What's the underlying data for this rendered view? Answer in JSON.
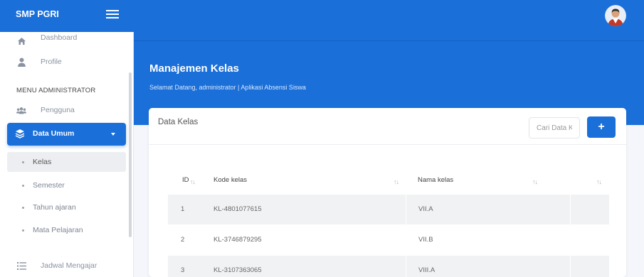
{
  "app": {
    "brand": "SMP PGRI"
  },
  "sidebar": {
    "items": [
      {
        "label": "Dashboard",
        "icon": "home-icon"
      },
      {
        "label": "Profile",
        "icon": "user-icon"
      }
    ],
    "section_heading": "MENU ADMINISTRATOR",
    "pengguna": {
      "label": "Pengguna",
      "icon": "users-icon"
    },
    "active_group": {
      "label": "Data Umum",
      "icon": "layers-icon"
    },
    "sub_items": [
      {
        "label": "Kelas",
        "selected": true
      },
      {
        "label": "Semester"
      },
      {
        "label": "Tahun ajaran"
      },
      {
        "label": "Mata Pelajaran"
      }
    ],
    "jadwal": {
      "label": "Jadwal Mengajar",
      "icon": "list-icon"
    }
  },
  "header": {
    "title": "Manajemen Kelas",
    "subtitle": "Selamat Datang, administrator | Aplikasi Absensi Siswa"
  },
  "card": {
    "title": "Data Kelas",
    "search_placeholder": "Cari Data Kelas",
    "add_label": "+"
  },
  "table": {
    "columns": [
      "ID",
      "Kode kelas",
      "Nama kelas",
      ""
    ],
    "rows": [
      {
        "id": "1",
        "kode": "KL-4801077615",
        "nama": "VII.A"
      },
      {
        "id": "2",
        "kode": "KL-3746879295",
        "nama": "VII.B"
      },
      {
        "id": "3",
        "kode": "KL-3107363065",
        "nama": "VIII.A"
      }
    ],
    "sort_icon": "↑↓"
  },
  "colors": {
    "primary": "#1a6fd9",
    "sidebar_bg": "#ffffff",
    "page_bg": "#f4f6fb"
  }
}
